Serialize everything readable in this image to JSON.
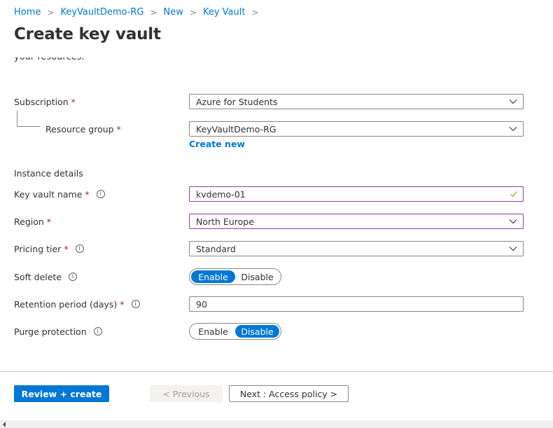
{
  "breadcrumb": [
    "Home",
    "KeyVaultDemo-RG",
    "New",
    "Key Vault"
  ],
  "page_title": "Create key vault",
  "clipped_text": "your resources.",
  "form": {
    "subscription": {
      "label": "Subscription",
      "required": "*",
      "value": "Azure for Students"
    },
    "resource_group": {
      "label": "Resource group",
      "required": "*",
      "value": "KeyVaultDemo-RG",
      "create_new": "Create new"
    },
    "section_instance": "Instance details",
    "key_vault_name": {
      "label": "Key vault name",
      "required": "*",
      "value": "kvdemo-01",
      "valid": true
    },
    "region": {
      "label": "Region",
      "required": "*",
      "value": "North Europe"
    },
    "pricing_tier": {
      "label": "Pricing tier",
      "required": "*",
      "value": "Standard"
    },
    "soft_delete": {
      "label": "Soft delete",
      "options": [
        "Enable",
        "Disable"
      ],
      "selected": "Enable"
    },
    "retention": {
      "label": "Retention period (days)",
      "required": "*",
      "value": "90"
    },
    "purge_protection": {
      "label": "Purge protection",
      "options": [
        "Enable",
        "Disable"
      ],
      "selected": "Disable"
    }
  },
  "footer": {
    "review_create": "Review + create",
    "previous": "< Previous",
    "next": "Next : Access policy >"
  },
  "info_glyph": "i",
  "colors": {
    "accent": "#0078d4",
    "focus_border": "#8b3fa0",
    "required": "#a4262c",
    "valid_check": "#6bb700"
  }
}
